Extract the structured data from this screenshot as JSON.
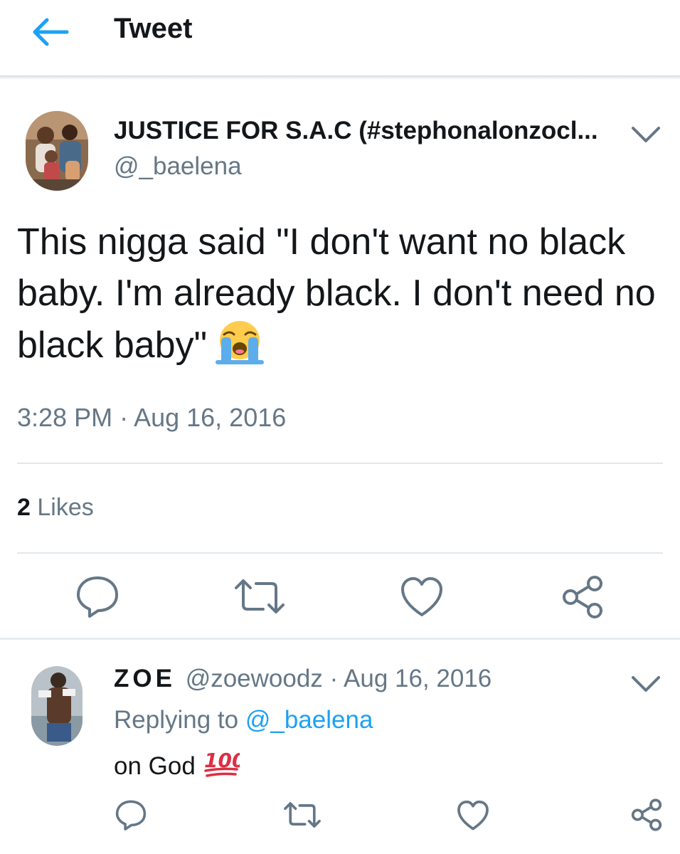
{
  "header": {
    "title": "Tweet",
    "back_icon": "arrow-left-icon",
    "accent_color": "#1da1f2"
  },
  "tweet": {
    "author_name": "JUSTICE FOR S.A.C (#stephonalonzocl...",
    "handle": "@_baelena",
    "text": "This nigga said \"I don't want no black baby. I'm already black. I don't need no black baby\"",
    "emoji": "loudly-crying-face-emoji",
    "timestamp": "3:28 PM · Aug 16, 2016",
    "likes_count": "2",
    "likes_label": "Likes",
    "actions": [
      "reply-icon",
      "retweet-icon",
      "like-icon",
      "share-icon"
    ]
  },
  "reply": {
    "author_name": "ZOE",
    "handle": "@zoewoodz",
    "date": "· Aug 16, 2016",
    "replying_prefix": "Replying to",
    "replying_to": "@_baelena",
    "text": "on God",
    "emoji": "hundred-points-emoji",
    "actions": [
      "reply-icon",
      "retweet-icon",
      "like-icon",
      "share-icon"
    ]
  },
  "colors": {
    "text": "#14171a",
    "secondary": "#657786",
    "link": "#1da1f2",
    "divider": "#e1e8ed"
  }
}
